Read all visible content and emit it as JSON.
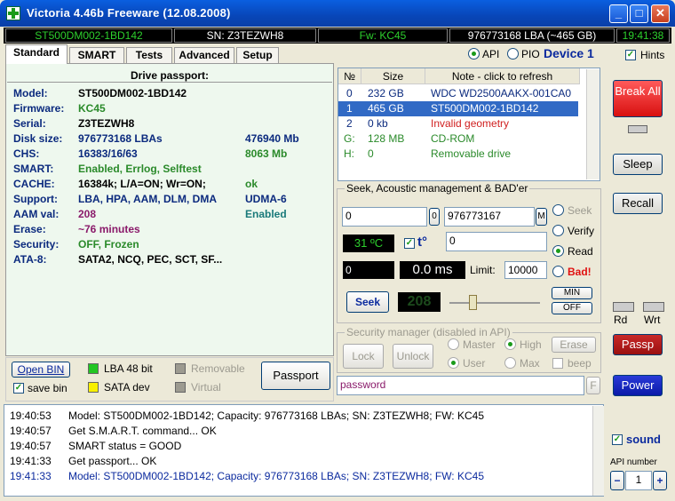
{
  "window": {
    "title": "Victoria 4.46b Freeware (12.08.2008)",
    "min": "_",
    "max": "□",
    "close": "✕"
  },
  "infobar": {
    "model": "ST500DM002-1BD142",
    "serial": "SN: Z3TEZWH8",
    "firmware": "Fw: KC45",
    "lba": "976773168 LBA (~465 GB)",
    "time": "19:41:38"
  },
  "tabs": [
    "Standard",
    "SMART",
    "Tests",
    "Advanced",
    "Setup"
  ],
  "api": {
    "api_label": "API",
    "pio_label": "PIO",
    "device": "Device 1",
    "hints": "Hints"
  },
  "passport": {
    "title": "Drive passport:",
    "rows": [
      {
        "label": "Model:",
        "value": "ST500DM002-1BD142",
        "value2": ""
      },
      {
        "label": "Firmware:",
        "value": "KC45",
        "value2": ""
      },
      {
        "label": "Serial:",
        "value": "Z3TEZWH8",
        "value2": ""
      },
      {
        "label": "Disk size:",
        "value": "976773168 LBAs",
        "value2": "476940 Mb"
      },
      {
        "label": "CHS:",
        "value": "16383/16/63",
        "value2": "8063 Mb"
      },
      {
        "label": "SMART:",
        "value": "Enabled, Errlog, Selftest",
        "value2": ""
      },
      {
        "label": "CACHE:",
        "value": "16384k; L/A=ON; Wr=ON;",
        "value2": "ok"
      },
      {
        "label": "Support:",
        "value": "LBA, HPA, AAM, DLM, DMA",
        "value2": "UDMA-6"
      },
      {
        "label": "AAM val:",
        "value": "208",
        "value2": "Enabled"
      },
      {
        "label": "Erase:",
        "value": "~76 minutes",
        "value2": ""
      },
      {
        "label": "Security:",
        "value": "OFF, Frozen",
        "value2": ""
      },
      {
        "label": "ATA-8:",
        "value": "SATA2, NCQ, PEC, SCT, SF...",
        "value2": ""
      }
    ]
  },
  "bottom": {
    "open_bin": "Open BIN",
    "save_bin": "save bin",
    "lba48": "LBA 48 bit",
    "sata": "SATA dev",
    "removable": "Removable",
    "virtual": "Virtual",
    "passport_btn": "Passport"
  },
  "drives": {
    "headers": [
      "№",
      "Size",
      "Note - click to refresh"
    ],
    "rows": [
      {
        "n": "0",
        "size": "232 GB",
        "note": "WDC WD2500AAKX-001CA0"
      },
      {
        "n": "1",
        "size": "465 GB",
        "note": "ST500DM002-1BD142"
      },
      {
        "n": "2",
        "size": "0 kb",
        "note": "Invalid geometry"
      },
      {
        "n": "G:",
        "size": "128 MB",
        "note": "CD-ROM"
      },
      {
        "n": "H:",
        "size": "0",
        "note": "Removable drive"
      }
    ]
  },
  "seek": {
    "title": "Seek, Acoustic management & BAD'er",
    "start": "0",
    "start_btn": "0",
    "end": "976773167",
    "end_btn": "M",
    "temp": "31 ºC",
    "t_label": "t°",
    "temp_field": "0",
    "pos": "0",
    "ms": "0.0 ms",
    "limit_label": "Limit:",
    "limit": "10000",
    "seek_btn": "Seek",
    "seek_display": "208",
    "min_btn": "MIN",
    "off_btn": "OFF",
    "opt_seek": "Seek",
    "opt_verify": "Verify",
    "opt_read": "Read",
    "opt_bad": "Bad!"
  },
  "security": {
    "title": "Security manager (disabled in API)",
    "lock": "Lock",
    "unlock": "Unlock",
    "master": "Master",
    "user": "User",
    "high": "High",
    "max": "Max",
    "erase": "Erase",
    "beep": "beep",
    "password": "password",
    "f_btn": "F"
  },
  "right": {
    "break": "Break All",
    "sleep": "Sleep",
    "recall": "Recall",
    "rd": "Rd",
    "wrt": "Wrt",
    "passp": "Passp",
    "power": "Power",
    "sound": "sound",
    "api_number_label": "API number",
    "api_number": "1",
    "minus": "−",
    "plus": "+"
  },
  "log": [
    {
      "time": "19:40:53",
      "msg": "Model: ST500DM002-1BD142; Capacity: 976773168 LBAs; SN: Z3TEZWH8; FW: KC45"
    },
    {
      "time": "19:40:57",
      "msg": "Get S.M.A.R.T. command... OK"
    },
    {
      "time": "19:40:57",
      "msg": "SMART status = GOOD"
    },
    {
      "time": "19:41:33",
      "msg": "Get passport... OK"
    },
    {
      "time": "19:41:33",
      "msg": "Model: ST500DM002-1BD142; Capacity: 976773168 LBAs; SN: Z3TEZWH8; FW: KC45"
    }
  ]
}
